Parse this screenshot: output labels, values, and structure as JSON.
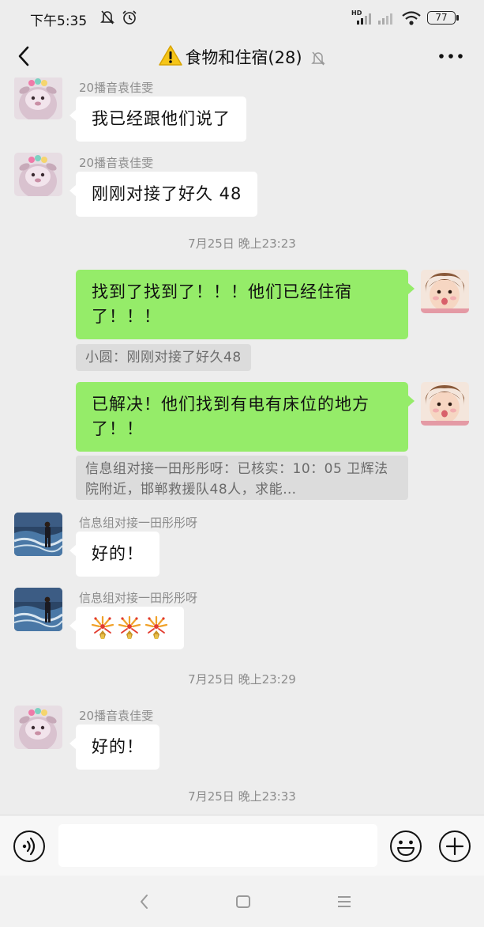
{
  "status_bar": {
    "time": "下午5:35",
    "network_label": "HD",
    "battery": "77",
    "icons": [
      "mute-bell-icon",
      "alarm-icon",
      "signal-icon",
      "signal-weak-icon",
      "wifi-icon",
      "battery-icon"
    ]
  },
  "header": {
    "title": "食物和住宿(28)",
    "icons": [
      "back-arrow-icon",
      "warning-icon",
      "muted-bell-icon",
      "more-dots-icon"
    ]
  },
  "messages": [
    {
      "type": "received",
      "sender": "20播音袁佳雯",
      "avatar": "sheep-avatar",
      "text": "我已经跟他们说了"
    },
    {
      "type": "received",
      "sender": "20播音袁佳雯",
      "avatar": "sheep-avatar",
      "text": "刚刚对接了好久 48"
    },
    {
      "type": "timestamp",
      "text": "7月25日 晚上23:23"
    },
    {
      "type": "sent",
      "avatar": "child-avatar",
      "text": "找到了找到了！！！他们已经住宿了！！！",
      "quote": "小圆：刚刚对接了好久48"
    },
    {
      "type": "sent",
      "avatar": "child-avatar",
      "text": "已解决！他们找到有电有床位的地方了！！",
      "quote": "信息组对接一田彤彤呀：已核实：10：05 卫辉法院附近，邯郸救援队48人，求能…"
    },
    {
      "type": "received",
      "sender": "信息组对接一田彤彤呀",
      "avatar": "beach-avatar",
      "text": "好的！"
    },
    {
      "type": "received",
      "sender": "信息组对接一田彤彤呀",
      "avatar": "beach-avatar",
      "text": "",
      "stickers": [
        "firework-icon",
        "firework-icon",
        "firework-icon"
      ]
    },
    {
      "type": "timestamp",
      "text": "7月25日 晚上23:29"
    },
    {
      "type": "received",
      "sender": "20播音袁佳雯",
      "avatar": "sheep-avatar",
      "text": "好的！"
    },
    {
      "type": "timestamp",
      "text": "7月25日 晚上23:33"
    }
  ],
  "input_bar": {
    "value": "",
    "icons": [
      "voice-icon",
      "emoji-icon",
      "plus-icon"
    ]
  },
  "nav_bar": {
    "icons": [
      "nav-back-icon",
      "nav-home-icon",
      "nav-menu-icon"
    ]
  },
  "colors": {
    "background": "#ededed",
    "sent_bubble": "#95ec69",
    "received_bubble": "#ffffff",
    "quote_bg": "#dcdcdc",
    "meta_text": "#8c8c8c",
    "warning": "#f5c518"
  }
}
